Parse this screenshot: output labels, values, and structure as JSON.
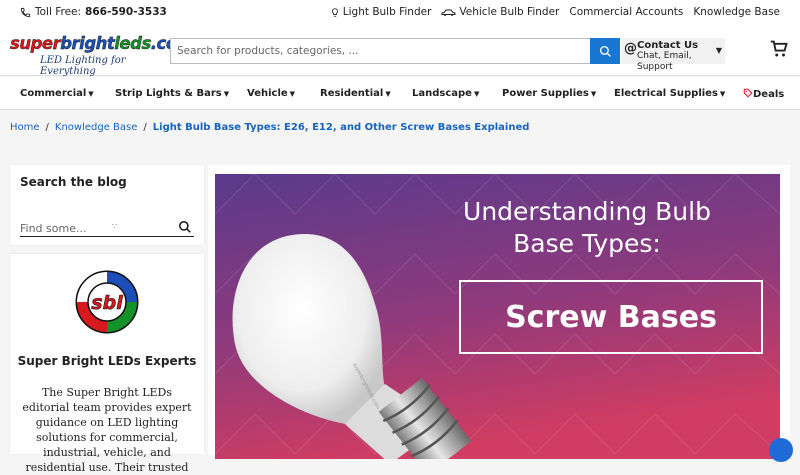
{
  "topbar": {
    "toll_free_label": "Toll Free:",
    "phone": "866-590-3533",
    "links": [
      "Light Bulb Finder",
      "Vehicle Bulb Finder",
      "Commercial Accounts",
      "Knowledge Base"
    ]
  },
  "header": {
    "logo_text": "superbrightleds.com",
    "logo_tagline": "LED Lighting for Everything",
    "search_placeholder": "Search for products, categories, ...",
    "contact_title": "Contact Us",
    "contact_sub": "Chat, Email, Support"
  },
  "nav": {
    "items": [
      "Commercial",
      "Strip Lights & Bars",
      "Vehicle",
      "Residential",
      "Landscape",
      "Power Supplies",
      "Electrical Supplies",
      "Deals"
    ]
  },
  "breadcrumb": {
    "home": "Home",
    "section": "Knowledge Base",
    "current": "Light Bulb Base Types: E26, E12, and Other Screw Bases Explained"
  },
  "sidebar": {
    "search_title": "Search the blog",
    "search_placeholder": "Find some...",
    "author_emblem_text": "sbl",
    "author_title": "Super Bright LEDs Experts",
    "author_desc": "The Super Bright LEDs editorial team provides expert guidance on LED lighting solutions for commercial, industrial, vehicle, and residential use. Their trusted"
  },
  "hero": {
    "heading": "Understanding Bulb Base Types:",
    "boxed_text": "Screw Bases"
  },
  "colors": {
    "accent": "#1976d2",
    "hero_bg_top": "#5c3a8a",
    "hero_bg_bottom": "#d23a6a"
  }
}
